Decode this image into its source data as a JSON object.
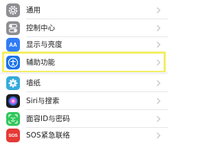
{
  "settings": {
    "items": [
      {
        "label": "通用",
        "icon": "gear-icon",
        "color": "#8e8e93"
      },
      {
        "label": "控制中心",
        "icon": "toggles-icon",
        "color": "#8e8e93"
      },
      {
        "label": "显示与亮度",
        "icon": "aa-icon",
        "color": "#2f7cf6",
        "icon_text": "AA"
      },
      {
        "label": "辅助功能",
        "icon": "accessibility-icon",
        "color": "#1a73e8"
      },
      {
        "label": "墙纸",
        "icon": "flower-icon",
        "color": "#34aadc"
      },
      {
        "label": "Siri与搜索",
        "icon": "siri-icon",
        "color": "#1c1c1e"
      },
      {
        "label": "面容ID与密码",
        "icon": "face-id-icon",
        "color": "#30c85a"
      },
      {
        "label": "SOS紧急联络",
        "icon": "sos-icon",
        "color": "#e53935",
        "icon_text": "SOS"
      }
    ],
    "highlight_color": "#f4ee60",
    "chevron_color": "#c7c7cc"
  }
}
